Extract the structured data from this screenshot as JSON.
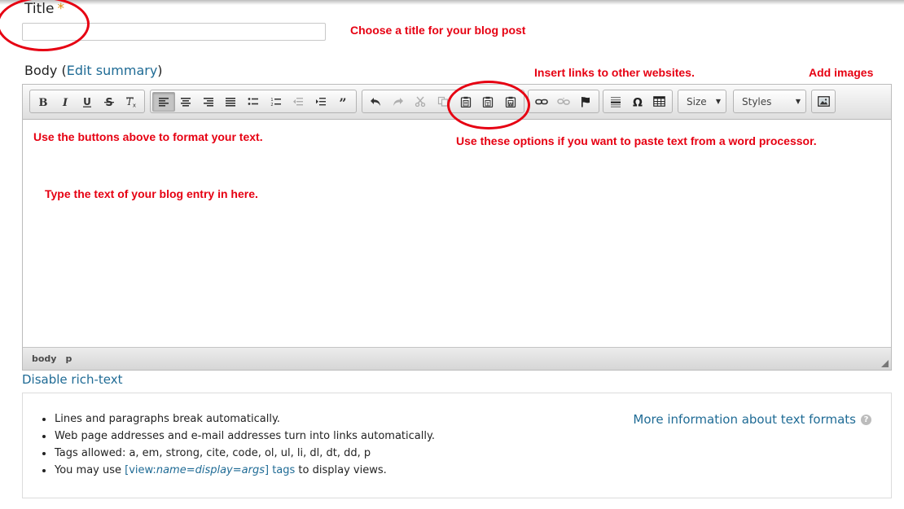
{
  "title_field": {
    "label": "Title",
    "required_mark": "*",
    "value": ""
  },
  "body_field": {
    "label_prefix": "Body (",
    "edit_summary": "Edit summary",
    "label_suffix": ")"
  },
  "annotations": {
    "title_hint": "Choose a title for your blog post",
    "links_hint": "Insert links to other websites.",
    "images_hint": "Add images",
    "format_hint": "Use the buttons above to format your text.",
    "paste_hint": "Use these options if you want to paste text from a word processor.",
    "type_hint": "Type the text of your blog entry in here.",
    "color": "#e60012"
  },
  "toolbar": {
    "basic": [
      "bold-icon",
      "italic-icon",
      "underline-icon",
      "strikethrough-icon",
      "remove-format-icon"
    ],
    "paragraph": [
      "align-left-icon",
      "align-center-icon",
      "align-right-icon",
      "justify-icon",
      "bulleted-list-icon",
      "numbered-list-icon",
      "outdent-icon",
      "indent-icon",
      "blockquote-icon"
    ],
    "clipboard": [
      "undo-icon",
      "redo-icon",
      "cut-icon",
      "copy-icon",
      "paste-icon",
      "paste-text-icon",
      "paste-word-icon"
    ],
    "links": [
      "link-icon",
      "unlink-icon",
      "anchor-icon"
    ],
    "insert": [
      "horizontal-rule-icon",
      "special-char-icon",
      "table-icon"
    ],
    "size_label": "Size",
    "styles_label": "Styles",
    "image": [
      "image-icon"
    ]
  },
  "status_bar": {
    "path": [
      "body",
      "p"
    ]
  },
  "disable_rich_text": "Disable rich-text",
  "text_format": {
    "more_info": "More information about text formats",
    "help_glyph": "?",
    "tips": [
      "Lines and paragraphs break automatically.",
      "Web page addresses and e-mail addresses turn into links automatically.",
      "Tags allowed: a, em, strong, cite, code, ol, ul, li, dl, dt, dd, p"
    ],
    "views_tip": {
      "prefix": "You may use ",
      "link_open": "[view:",
      "link_italic": "name=display=args",
      "link_close": "] tags",
      "suffix": " to display views."
    }
  },
  "colors": {
    "link": "#1f6b95",
    "required": "#e09010"
  }
}
